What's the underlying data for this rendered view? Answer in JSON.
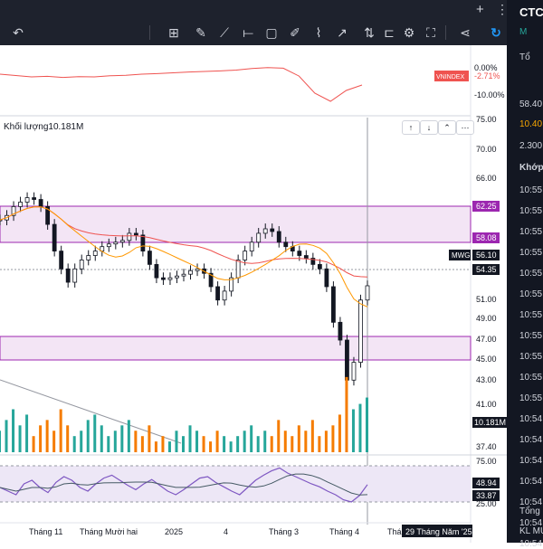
{
  "toolbar": {
    "undo_icon": "undo-icon",
    "tools": [
      "crosshair",
      "pencil",
      "line",
      "horizontal-line",
      "rectangle",
      "brush",
      "path",
      "arrow",
      "vertical-line",
      "fib",
      "settings",
      "fullscreen",
      "share",
      "refresh"
    ]
  },
  "topbar": {
    "plus": "+",
    "menu": "⋮"
  },
  "index_pane": {
    "label": "VNINDEX",
    "change": "-2.71%",
    "ticks": [
      "0.00%",
      "-10.00%"
    ]
  },
  "volume": {
    "title": "Khối lượng",
    "value_text": "10.181M",
    "badge": "10.181M"
  },
  "price_axis": {
    "ticks": [
      "75.00",
      "70.00",
      "66.00",
      "51.00",
      "49.00",
      "47.00",
      "45.00",
      "43.00",
      "41.00",
      "39.00",
      "37.40"
    ],
    "badges": [
      {
        "text": "62.25",
        "color": "#9c27b0"
      },
      {
        "text": "58.08",
        "color": "#9c27b0"
      },
      {
        "text": "56.10",
        "color": "#131722"
      },
      {
        "text": "54.35",
        "color": "#131722"
      }
    ],
    "symbol_tag": "MWG"
  },
  "rsi_axis": {
    "ticks": [
      "75.00",
      "25.00"
    ],
    "badges": [
      {
        "text": "48.94",
        "color": "#131722"
      },
      {
        "text": "33.87",
        "color": "#131722"
      }
    ]
  },
  "time_axis": {
    "labels": [
      "Tháng 11",
      "Tháng Mười hai",
      "2025",
      "4",
      "Tháng 3",
      "Tháng 4",
      "Tháng"
    ],
    "cursor_label": "29 Tháng Năm '25"
  },
  "right_panel": {
    "title": "CTCI",
    "lines": [
      "M",
      "Tổ",
      "58.40",
      "10.40",
      "2.300",
      "Khớp",
      "10:55",
      "10:55",
      "10:55",
      "10:55",
      "10:55",
      "10:55",
      "10:55",
      "10:55",
      "10:55",
      "10:55",
      "10:55",
      "10:54",
      "10:54",
      "10:54",
      "10:54",
      "10:54",
      "10:54",
      "10:54",
      "Tổng",
      "KL MU"
    ]
  },
  "colors": {
    "up": "#26a69a",
    "down": "#ef5350",
    "accent": "#9c27b0",
    "ma_slow": "#ef5350",
    "ma_fast": "#ff9800",
    "volume_orange": "#f57c00",
    "volume_green": "#26a69a"
  },
  "chart_data": [
    {
      "type": "line",
      "title": "VNINDEX",
      "series": [
        {
          "name": "VNINDEX",
          "values": [
            -2,
            -2.5,
            -3,
            -2.8,
            -3.2,
            -2.9,
            -3.0,
            -2.6,
            -2.4,
            -2.0,
            -1.8,
            -1.5,
            -1.2,
            -1.0,
            -0.8,
            -0.5,
            0.1,
            0.4,
            0.2,
            -2.71,
            -9,
            -12,
            -8,
            -6
          ]
        }
      ]
    },
    {
      "type": "line",
      "title": "MWG",
      "ylim": [
        37.4,
        75
      ],
      "zones": [
        [
          58.08,
          62.25
        ],
        [
          45.0,
          47.0
        ]
      ],
      "series": [
        {
          "name": "price",
          "values": [
            63.5,
            64,
            65,
            65.5,
            66,
            65.8,
            65,
            63,
            60,
            58,
            56.5,
            58,
            59,
            59.5,
            60,
            60.5,
            60.8,
            61,
            61.2,
            62,
            61.8,
            60,
            58.5,
            57,
            56.8,
            57,
            57.2,
            57.4,
            57.8,
            58,
            57.5,
            56,
            54.5,
            55.5,
            57,
            59,
            60,
            61,
            62,
            62.5,
            62.2,
            61,
            60.5,
            60,
            59.5,
            59.2,
            58.5,
            58,
            56,
            52,
            50,
            45.5,
            47.5,
            54.5,
            56.1
          ]
        }
      ]
    },
    {
      "type": "bar",
      "title": "Khối lượng",
      "series": [
        {
          "name": "Khối lượng",
          "values": [
            4,
            6,
            8,
            5,
            7,
            3,
            5,
            6,
            4,
            8,
            5,
            3,
            4,
            6,
            7,
            5,
            3,
            4,
            5,
            6,
            4,
            3,
            5,
            2,
            3,
            2,
            4,
            3,
            5,
            4,
            3,
            2,
            4,
            3,
            2,
            3,
            4,
            5,
            3,
            4,
            3,
            6,
            4,
            3,
            5,
            4,
            6,
            3,
            4,
            5,
            7,
            14,
            8,
            9,
            10.181
          ]
        }
      ]
    },
    {
      "type": "line",
      "title": "RSI",
      "ylim": [
        25,
        75
      ],
      "series": [
        {
          "name": "RSI",
          "values": [
            45,
            40,
            35,
            50,
            55,
            45,
            38,
            52,
            60,
            55,
            45,
            40,
            50,
            58,
            62,
            55,
            48,
            42,
            50,
            56,
            48,
            40,
            35,
            42,
            50,
            58,
            60,
            52,
            46,
            40,
            35,
            45,
            55,
            62,
            68,
            72,
            65,
            60,
            55,
            50,
            46,
            40,
            35,
            28,
            25,
            33.87,
            48.94
          ]
        }
      ]
    }
  ]
}
